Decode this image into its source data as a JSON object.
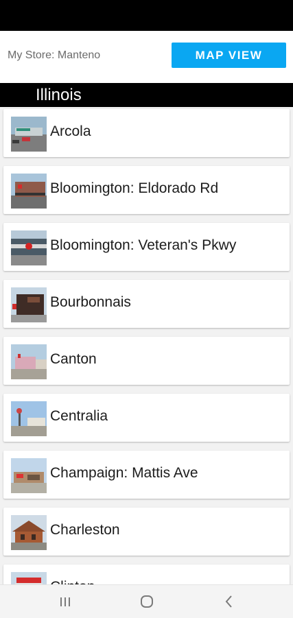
{
  "header": {
    "my_store": "My Store: Manteno",
    "map_view_label": "MAP VIEW"
  },
  "state": {
    "name": "Illinois"
  },
  "stores": [
    {
      "name": "Arcola"
    },
    {
      "name": "Bloomington: Eldorado Rd"
    },
    {
      "name": "Bloomington: Veteran's Pkwy"
    },
    {
      "name": "Bourbonnais"
    },
    {
      "name": "Canton"
    },
    {
      "name": "Centralia"
    },
    {
      "name": "Champaign: Mattis Ave"
    },
    {
      "name": "Charleston"
    },
    {
      "name": "Clinton"
    }
  ],
  "navigation": {
    "recent_apps_icon": "recent-apps-icon",
    "home_icon": "home-icon",
    "back_icon": "back-icon"
  }
}
